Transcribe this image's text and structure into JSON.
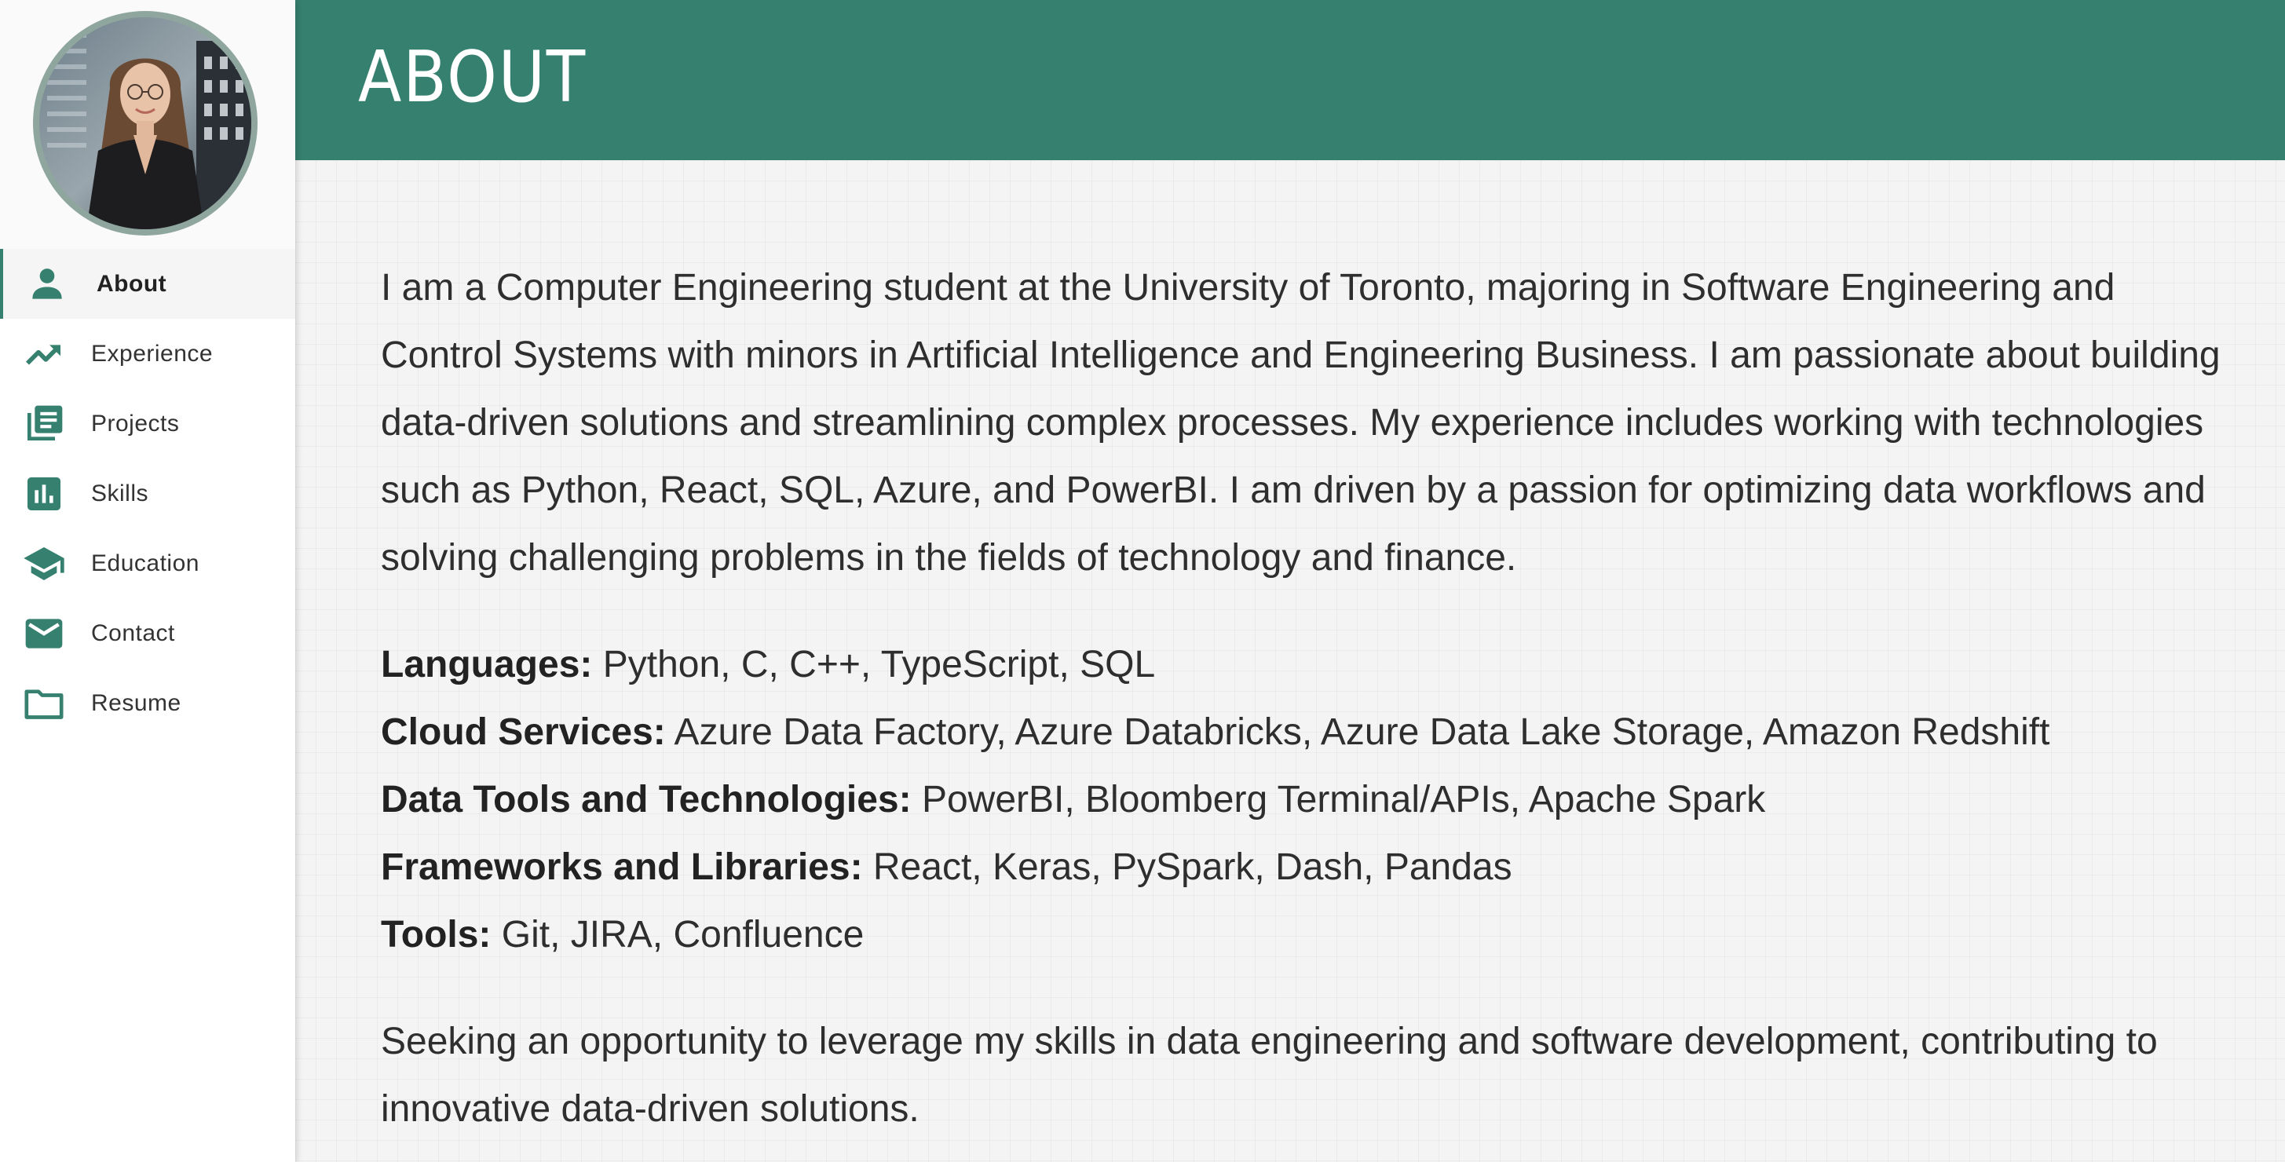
{
  "sidebar": {
    "items": [
      {
        "label": "About",
        "icon": "person-icon",
        "active": true
      },
      {
        "label": "Experience",
        "icon": "trending-up-icon",
        "active": false
      },
      {
        "label": "Projects",
        "icon": "article-stack-icon",
        "active": false
      },
      {
        "label": "Skills",
        "icon": "bar-chart-icon",
        "active": false
      },
      {
        "label": "Education",
        "icon": "graduation-cap-icon",
        "active": false
      },
      {
        "label": "Contact",
        "icon": "mail-icon",
        "active": false
      },
      {
        "label": "Resume",
        "icon": "folder-icon",
        "active": false
      }
    ]
  },
  "header": {
    "title": "ABOUT"
  },
  "about": {
    "intro": "I am a Computer Engineering student at the University of Toronto, majoring in Software Engineering and Control Systems with minors in Artificial Intelligence and Engineering Business. I am passionate about building data-driven solutions and streamlining complex processes. My experience includes working with technologies such as Python, React, SQL, Azure, and PowerBI. I am driven by a passion for optimizing data workflows and solving challenging problems in the fields of technology and finance.",
    "skills": [
      {
        "key": "Languages:",
        "value": "Python, C, C++, TypeScript, SQL"
      },
      {
        "key": "Cloud Services:",
        "value": "Azure Data Factory, Azure Databricks, Azure Data Lake Storage, Amazon Redshift"
      },
      {
        "key": "Data Tools and Technologies:",
        "value": "PowerBI, Bloomberg Terminal/APIs, Apache Spark"
      },
      {
        "key": "Frameworks and Libraries:",
        "value": "React, Keras, PySpark, Dash, Pandas"
      },
      {
        "key": "Tools:",
        "value": "Git, JIRA, Confluence"
      }
    ],
    "outro": "Seeking an opportunity to leverage my skills in data engineering and software development, contributing to innovative data-driven solutions."
  },
  "colors": {
    "accent": "#36806f",
    "sidebar_bg": "#ffffff",
    "main_bg": "#f4f4f4",
    "text": "#2e2e2e"
  }
}
